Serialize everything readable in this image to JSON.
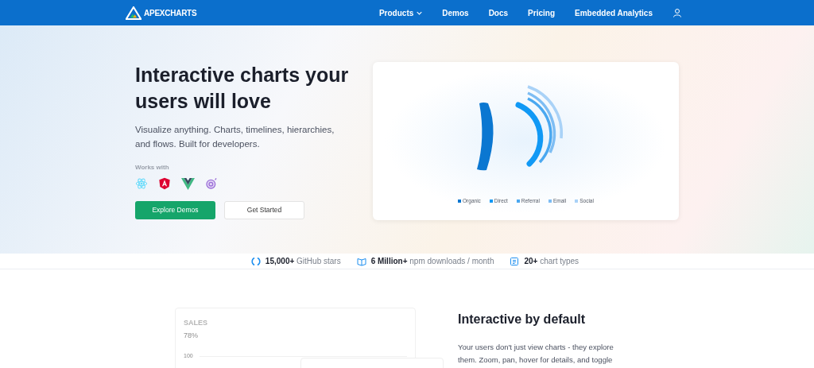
{
  "nav": {
    "brand": "APEXCHARTS",
    "links": [
      {
        "label": "Products",
        "dropdown": true
      },
      {
        "label": "Demos",
        "dropdown": false
      },
      {
        "label": "Docs",
        "dropdown": false
      },
      {
        "label": "Pricing",
        "dropdown": false
      },
      {
        "label": "Embedded Analytics",
        "dropdown": false
      }
    ]
  },
  "hero": {
    "title": "Interactive charts your users will love",
    "subtitle": "Visualize anything. Charts, timelines, hierarchies, and flows. Built for developers.",
    "works_with": "Works with",
    "frameworks": [
      {
        "kind": "react"
      },
      {
        "kind": "angular"
      },
      {
        "kind": "vue"
      },
      {
        "kind": "ember"
      }
    ],
    "buttons": [
      {
        "label": "Explore Demos",
        "kind": "primary"
      },
      {
        "label": "Get Started",
        "kind": "secondary"
      }
    ],
    "chart_legend": [
      {
        "label": "Organic",
        "color": "#0b77d1"
      },
      {
        "label": "Direct",
        "color": "#1199f5"
      },
      {
        "label": "Referral",
        "color": "#4aa8f0"
      },
      {
        "label": "Email",
        "color": "#7ebdf3"
      },
      {
        "label": "Social",
        "color": "#a9d2f7"
      }
    ]
  },
  "stats": [
    {
      "kind": "github",
      "value": "15,000+",
      "label": "GitHub stars"
    },
    {
      "kind": "npm",
      "value": "6 Million+",
      "label": "npm downloads / month"
    },
    {
      "kind": "types",
      "value": "20+",
      "label": "chart types"
    }
  ],
  "feature": {
    "card_title": "SALES",
    "card_value": "78%",
    "axis_label": "100",
    "heading": "Interactive by default",
    "text": "Your users don't just view charts - they explore them. Zoom, pan, hover for details, and toggle"
  }
}
